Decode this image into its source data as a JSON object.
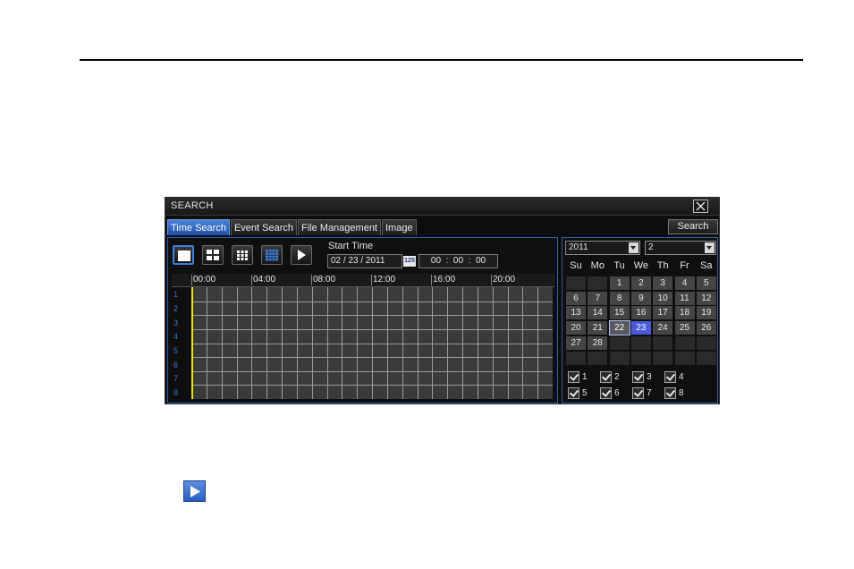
{
  "window": {
    "title": "SEARCH",
    "close_icon": "close-icon"
  },
  "tabs": [
    {
      "label": "Time Search",
      "active": true
    },
    {
      "label": "Event Search",
      "active": false
    },
    {
      "label": "File Management",
      "active": false
    },
    {
      "label": "Image",
      "active": false
    }
  ],
  "search_button": "Search",
  "mode_buttons": [
    "single-view-icon",
    "quad-view-icon",
    "nine-view-icon",
    "sixteen-view-icon",
    "play-icon"
  ],
  "start_time": {
    "label": "Start Time",
    "date": "02 / 23 / 2011",
    "date_icon": "125",
    "time": "00  :  00  :  00"
  },
  "timeline": {
    "hours": [
      "00:00",
      "04:00",
      "08:00",
      "12:00",
      "16:00",
      "20:00"
    ],
    "channels": [
      "1",
      "2",
      "3",
      "4",
      "5",
      "6",
      "7",
      "8"
    ]
  },
  "calendar": {
    "year": "2011",
    "month": "2",
    "weekdays": [
      "Su",
      "Mo",
      "Tu",
      "We",
      "Th",
      "Fr",
      "Sa"
    ],
    "days": [
      "",
      "",
      "1",
      "2",
      "3",
      "4",
      "5",
      "6",
      "7",
      "8",
      "9",
      "10",
      "11",
      "12",
      "13",
      "14",
      "15",
      "16",
      "17",
      "18",
      "19",
      "20",
      "21",
      "22",
      "23",
      "24",
      "25",
      "26",
      "27",
      "28",
      "",
      "",
      "",
      "",
      "",
      "",
      "",
      "",
      "",
      "",
      "",
      ""
    ],
    "today": "22",
    "selected": "23"
  },
  "channel_checks": [
    "1",
    "2",
    "3",
    "4",
    "5",
    "6",
    "7",
    "8"
  ],
  "colors": {
    "accent": "#3b7de0",
    "cursor": "#e8e300",
    "selected_day": "#4a5bd8"
  }
}
